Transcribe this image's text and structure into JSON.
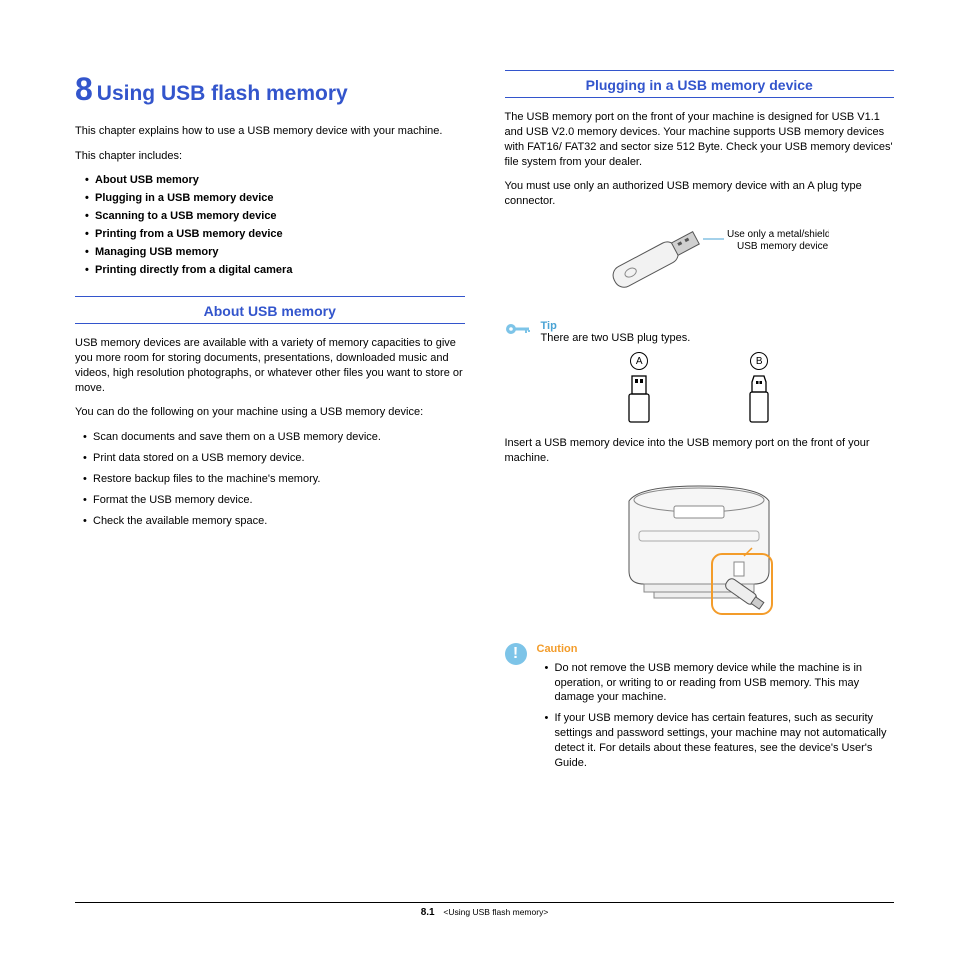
{
  "chapter": {
    "number": "8",
    "title": "Using USB flash memory"
  },
  "intro1": "This chapter explains how to use a USB memory device with your machine.",
  "intro2": "This chapter includes:",
  "toc": [
    "About USB memory",
    "Plugging in a USB memory device",
    "Scanning to a USB memory device",
    "Printing from a USB memory device",
    "Managing USB memory",
    "Printing directly from a digital camera"
  ],
  "section_about": {
    "title": "About USB memory",
    "p1": "USB memory devices are available with a variety of memory capacities to give you more room for storing documents, presentations, downloaded music and videos, high resolution photographs, or whatever other files you want to store or move.",
    "p2": "You can do the following on your machine using a USB memory device:",
    "list": [
      "Scan documents and save them on a USB memory device.",
      "Print data stored on a USB memory device.",
      "Restore backup files to the machine's memory.",
      "Format the USB memory device.",
      "Check the available memory space."
    ]
  },
  "section_plug": {
    "title": "Plugging in a USB memory device",
    "p1": "The USB memory port on the front of your machine is designed for USB V1.1 and USB V2.0 memory devices. Your machine supports USB memory devices with FAT16/ FAT32 and sector size 512 Byte. Check your USB memory devices' file system from your dealer.",
    "p2": "You must use only an authorized USB memory device with an A plug type connector.",
    "callout1": "Use only a metal/shielded",
    "callout2": "USB memory device.",
    "tip_label": "Tip",
    "tip_text": "There are two USB plug types.",
    "plug_a": "A",
    "plug_b": "B",
    "p3": "Insert a USB memory device into the USB memory port on the front of your machine.",
    "caution_label": "Caution",
    "caution_items": [
      "Do not remove the USB memory device while the machine is in operation, or writing to or reading from USB memory. This may damage your machine.",
      "If your USB memory device has certain features, such as security settings and password settings, your machine may not automatically detect it. For details about these features, see the device's User's Guide."
    ]
  },
  "footer": {
    "page": "8.1",
    "crumb": "<Using USB flash memory>"
  }
}
